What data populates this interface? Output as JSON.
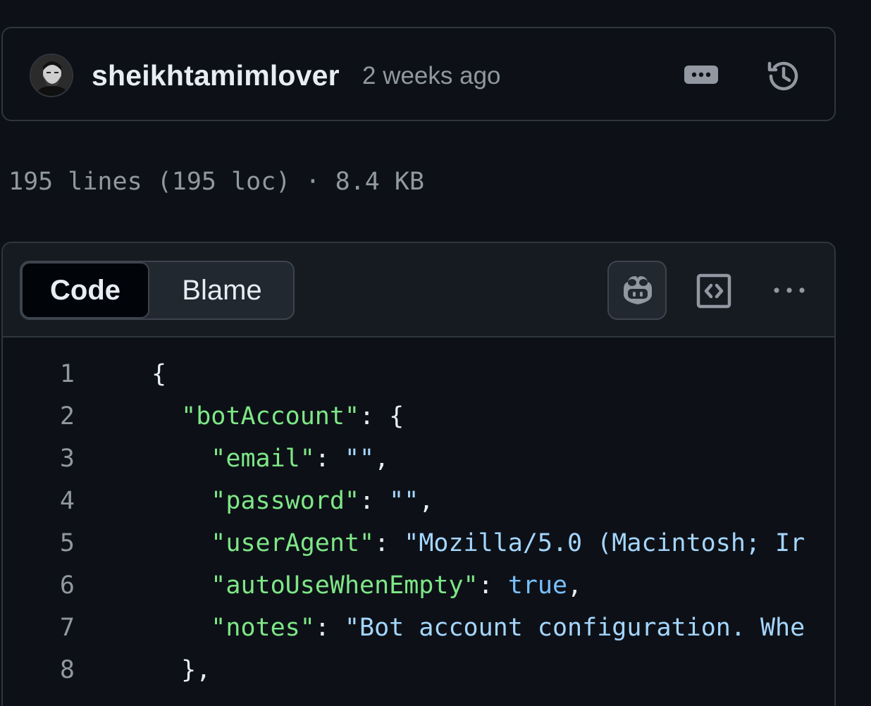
{
  "commit": {
    "author": "sheikhtamimlover",
    "time": "2 weeks ago"
  },
  "file_info": {
    "text": "195 lines (195 loc) · 8.4 KB"
  },
  "viewer": {
    "tabs": [
      {
        "label": "Code",
        "active": true
      },
      {
        "label": "Blame",
        "active": false
      }
    ]
  },
  "code": {
    "lines": [
      {
        "number": "1",
        "indent": "",
        "parts": [
          {
            "t": "p",
            "v": "{"
          }
        ]
      },
      {
        "number": "2",
        "indent": "  ",
        "parts": [
          {
            "t": "k",
            "v": "\"botAccount\""
          },
          {
            "t": "p",
            "v": ": {"
          }
        ]
      },
      {
        "number": "3",
        "indent": "    ",
        "parts": [
          {
            "t": "k",
            "v": "\"email\""
          },
          {
            "t": "p",
            "v": ": "
          },
          {
            "t": "s",
            "v": "\"\""
          },
          {
            "t": "p",
            "v": ","
          }
        ]
      },
      {
        "number": "4",
        "indent": "    ",
        "parts": [
          {
            "t": "k",
            "v": "\"password\""
          },
          {
            "t": "p",
            "v": ": "
          },
          {
            "t": "s",
            "v": "\"\""
          },
          {
            "t": "p",
            "v": ","
          }
        ]
      },
      {
        "number": "5",
        "indent": "    ",
        "parts": [
          {
            "t": "k",
            "v": "\"userAgent\""
          },
          {
            "t": "p",
            "v": ": "
          },
          {
            "t": "s",
            "v": "\"Mozilla/5.0 (Macintosh; Ir"
          }
        ]
      },
      {
        "number": "6",
        "indent": "    ",
        "parts": [
          {
            "t": "k",
            "v": "\"autoUseWhenEmpty\""
          },
          {
            "t": "p",
            "v": ": "
          },
          {
            "t": "b",
            "v": "true"
          },
          {
            "t": "p",
            "v": ","
          }
        ]
      },
      {
        "number": "7",
        "indent": "    ",
        "parts": [
          {
            "t": "k",
            "v": "\"notes\""
          },
          {
            "t": "p",
            "v": ": "
          },
          {
            "t": "s",
            "v": "\"Bot account configuration. Whe"
          }
        ]
      },
      {
        "number": "8",
        "indent": "  ",
        "parts": [
          {
            "t": "p",
            "v": "},"
          }
        ]
      }
    ]
  },
  "colors": {
    "background": "#0d1117",
    "border": "#30363d",
    "key": "#7ee787",
    "string": "#a5d6ff",
    "boolean": "#79c0ff",
    "muted": "#9198a1"
  },
  "icons": [
    "avatar",
    "kebab-horizontal-icon",
    "history-icon",
    "copilot-icon",
    "code-square-icon",
    "more-dots-icon"
  ]
}
